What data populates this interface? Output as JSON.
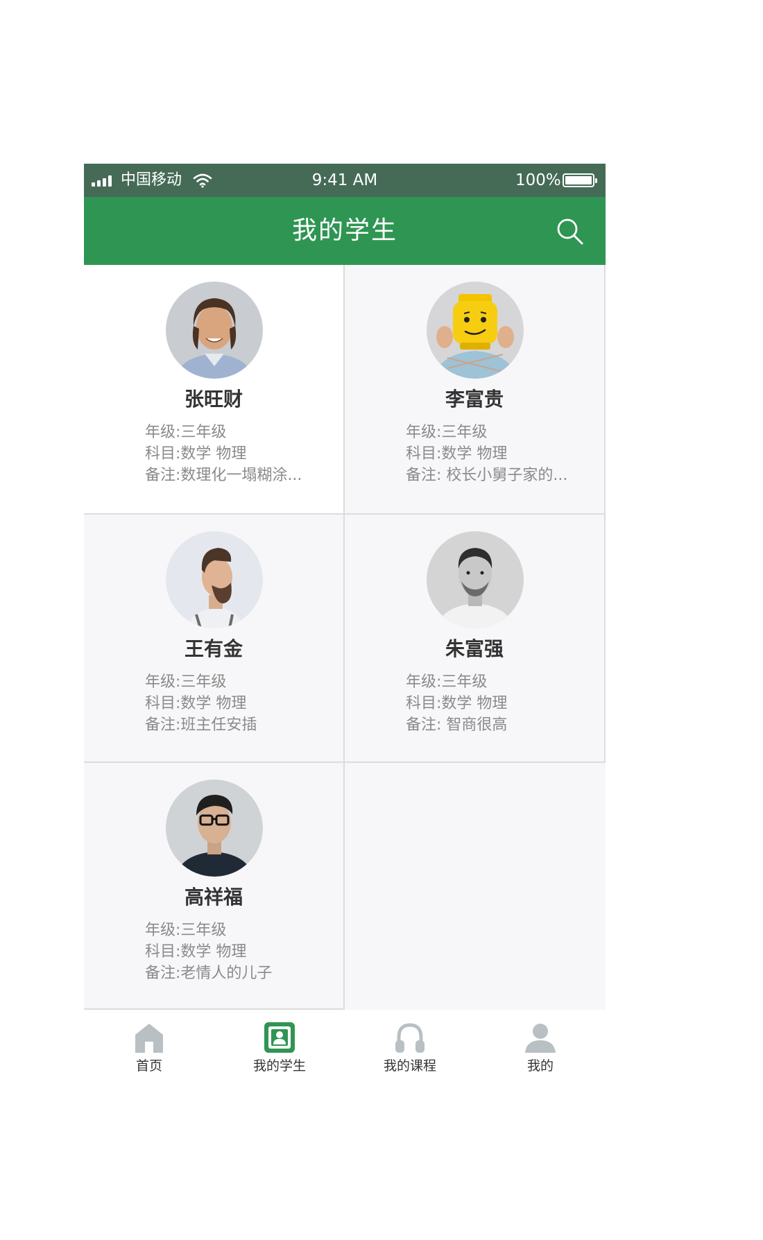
{
  "status_bar": {
    "carrier": "中国移动",
    "time": "9:41 AM",
    "battery": "100%"
  },
  "nav": {
    "title": "我的学生",
    "search_icon": "search-icon"
  },
  "students": [
    {
      "name": "张旺财",
      "grade": "年级:三年级",
      "subjects": "科目:数学 物理",
      "note": "备注:数理化一塌糊涂...",
      "avatar": "avatar-photo"
    },
    {
      "name": "李富贵",
      "grade": "年级:三年级",
      "subjects": "科目:数学 物理",
      "note": "备注: 校长小舅子家的...",
      "avatar": "avatar-photo"
    },
    {
      "name": "王有金",
      "grade": "年级:三年级",
      "subjects": "科目:数学 物理",
      "note": "备注:班主任安插",
      "avatar": "avatar-photo"
    },
    {
      "name": "朱富强",
      "grade": "年级:三年级",
      "subjects": "科目:数学 物理",
      "note": "备注: 智商很高",
      "avatar": "avatar-photo"
    },
    {
      "name": "高祥福",
      "grade": "年级:三年级",
      "subjects": "科目:数学 物理",
      "note": "备注:老情人的儿子",
      "avatar": "avatar-photo"
    }
  ],
  "tabs": [
    {
      "label": "首页",
      "icon": "home-icon",
      "active": false
    },
    {
      "label": "我的学生",
      "icon": "contact-card-icon",
      "active": true
    },
    {
      "label": "我的课程",
      "icon": "headphones-icon",
      "active": false
    },
    {
      "label": "我的",
      "icon": "user-icon",
      "active": false
    }
  ],
  "colors": {
    "status_bar": "#456b57",
    "nav_bar": "#2f9553",
    "tab_active": "#2f9553",
    "tab_inactive": "#b8c0c4"
  }
}
